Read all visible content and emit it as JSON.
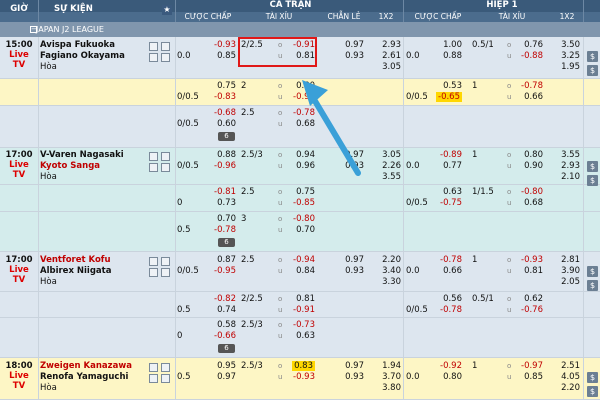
{
  "header": {
    "gio": "GIỜ",
    "su_kien": "SỰ KIỆN",
    "full_match": "CẢ TRẬN",
    "half1": "HIỆP 1",
    "cuoc_chap": "CƯỢC CHẤP",
    "tai_xiu": "TÀI XỈU",
    "chan_le": "CHẴN LẺ",
    "x12": "1X2",
    "cuoc_chap_h1": "CƯỢC CHẤP",
    "tai_xiu_h1": "TÀI XỈU",
    "x12_h1": "1X2"
  },
  "league": {
    "name": "JAPAN J2 LEAGUE",
    "toggle": "−"
  },
  "o_label": "o",
  "u_label": "u",
  "matches": [
    {
      "time": "15:00",
      "live": "Live",
      "tv": "TV",
      "home": "Avispa Fukuoka",
      "away": "Fagiano Okayama",
      "draw": "Hòa",
      "away_red": false,
      "home_red": false,
      "hdp_line": "0.0",
      "hdp_home": "-0.93",
      "hdp_away": "0.85",
      "ou_line": "2/2.5",
      "ou_over": "-0.91",
      "ou_under": "0.81",
      "oe_odd": "0.97",
      "oe_even": "0.93",
      "x1": "2.93",
      "x2": "2.61",
      "xd": "3.05",
      "h1_hdp_line": "0.0",
      "h1_hdp_home": "1.00",
      "h1_hdp_away": "0.88",
      "h1_ou_line": "0.5/1",
      "h1_ou_over": "0.76",
      "h1_ou_under": "-0.88",
      "h1_x1": "3.50",
      "h1_x2": "3.25",
      "h1_xd": "1.95"
    },
    {
      "time": "17:00",
      "live": "Live",
      "tv": "TV",
      "home": "V-Varen Nagasaki",
      "away": "Kyoto Sanga",
      "draw": "Hòa",
      "away_red": true,
      "home_red": false,
      "hdp_line": "0/0.5",
      "hdp_home": "0.88",
      "hdp_away": "-0.96",
      "ou_line": "2.5/3",
      "ou_over": "0.94",
      "ou_under": "0.96",
      "oe_odd": "0.97",
      "oe_even": "0.93",
      "x1": "3.05",
      "x2": "2.26",
      "xd": "3.55",
      "h1_hdp_line": "0.0",
      "h1_hdp_home": "-0.89",
      "h1_hdp_away": "0.77",
      "h1_ou_line": "1",
      "h1_ou_over": "0.80",
      "h1_ou_under": "0.90",
      "h1_x1": "3.55",
      "h1_x2": "2.93",
      "h1_xd": "2.10"
    },
    {
      "time": "17:00",
      "live": "Live",
      "tv": "TV",
      "home": "Ventforet Kofu",
      "away": "Albirex Niigata",
      "draw": "Hòa",
      "away_red": false,
      "home_red": true,
      "hdp_line": "0/0.5",
      "hdp_home": "0.87",
      "hdp_away": "-0.95",
      "ou_line": "2.5",
      "ou_over": "-0.94",
      "ou_under": "0.84",
      "oe_odd": "0.97",
      "oe_even": "0.93",
      "x1": "2.20",
      "x2": "3.40",
      "xd": "3.30",
      "h1_hdp_line": "0.0",
      "h1_hdp_home": "-0.78",
      "h1_hdp_away": "0.66",
      "h1_ou_line": "1",
      "h1_ou_over": "-0.93",
      "h1_ou_under": "0.81",
      "h1_x1": "2.81",
      "h1_x2": "3.90",
      "h1_xd": "2.05"
    },
    {
      "time": "18:00",
      "live": "Live",
      "tv": "TV",
      "home": "Zweigen Kanazawa",
      "away": "Renofa Yamaguchi",
      "draw": "Hòa",
      "away_red": false,
      "home_red": true,
      "hdp_line": "0.5",
      "hdp_home": "0.95",
      "hdp_away": "0.97",
      "ou_line": "2.5/3",
      "ou_over": "0.83",
      "ou_under": "-0.93",
      "oe_odd": "0.97",
      "oe_even": "0.93",
      "x1": "1.94",
      "x2": "3.70",
      "xd": "3.80",
      "h1_hdp_line": "0.0",
      "h1_hdp_home": "-0.92",
      "h1_hdp_away": "0.80",
      "h1_ou_line": "1",
      "h1_ou_over": "-0.97",
      "h1_ou_under": "0.85",
      "h1_x1": "2.51",
      "h1_x2": "4.05",
      "h1_xd": "2.20"
    }
  ],
  "extra_rows": [
    {
      "hdp_line": "0/0.5",
      "hdp_home": "0.75",
      "hdp_away": "-0.83",
      "ou_line": "2",
      "ou_over": "0.80",
      "ou_under": "-0.90",
      "h1_hdp_line": "0/0.5",
      "h1_hdp_home": "0.53",
      "h1_hdp_away": "-0.65",
      "h1_ou_line": "1",
      "h1_ou_over": "-0.78",
      "h1_ou_under": "0.66"
    },
    {
      "hdp_line": "0/0.5",
      "hdp_home": "-0.68",
      "hdp_away": "0.60",
      "ou_line": "2.5",
      "ou_over": "-0.78",
      "ou_under": "0.68",
      "badge": "6"
    },
    {
      "hdp_line": "0",
      "hdp_home": "-0.81",
      "hdp_away": "0.73",
      "ou_line": "2.5",
      "ou_over": "0.75",
      "ou_under": "-0.85",
      "h1_hdp_line": "0/0.5",
      "h1_hdp_home": "0.63",
      "h1_hdp_away": "-0.75",
      "h1_ou_line": "1/1.5",
      "h1_ou_over": "-0.80",
      "h1_ou_under": "0.68"
    },
    {
      "hdp_line": "0.5",
      "hdp_home": "0.70",
      "hdp_away": "-0.78",
      "ou_line": "3",
      "ou_over": "-0.80",
      "ou_under": "0.70",
      "badge": "6"
    },
    {
      "hdp_line": "0.5",
      "hdp_home": "-0.82",
      "hdp_away": "0.74",
      "ou_line": "2/2.5",
      "ou_over": "0.81",
      "ou_under": "-0.91",
      "h1_hdp_line": "0/0.5",
      "h1_hdp_home": "0.56",
      "h1_hdp_away": "-0.78",
      "h1_ou_line": "0.5/1",
      "h1_ou_over": "0.62",
      "h1_ou_under": "-0.76"
    },
    {
      "hdp_line": "0",
      "hdp_home": "0.58",
      "hdp_away": "-0.66",
      "ou_line": "2.5/3",
      "ou_over": "-0.73",
      "ou_under": "0.63",
      "badge": "6"
    }
  ],
  "icons": {
    "star": "★",
    "dollar": "$"
  },
  "colors": {
    "header_bg": "#3a5a7a",
    "row_blue": "#dde6ef",
    "row_yellow": "#fdf6c5",
    "row_teal": "#d4ecec",
    "row_lightteal": "#e6f4f4",
    "negative": "#c00000",
    "highlight": "#ffd700",
    "arrow": "#3aa0d8",
    "callout": "#e01818"
  }
}
